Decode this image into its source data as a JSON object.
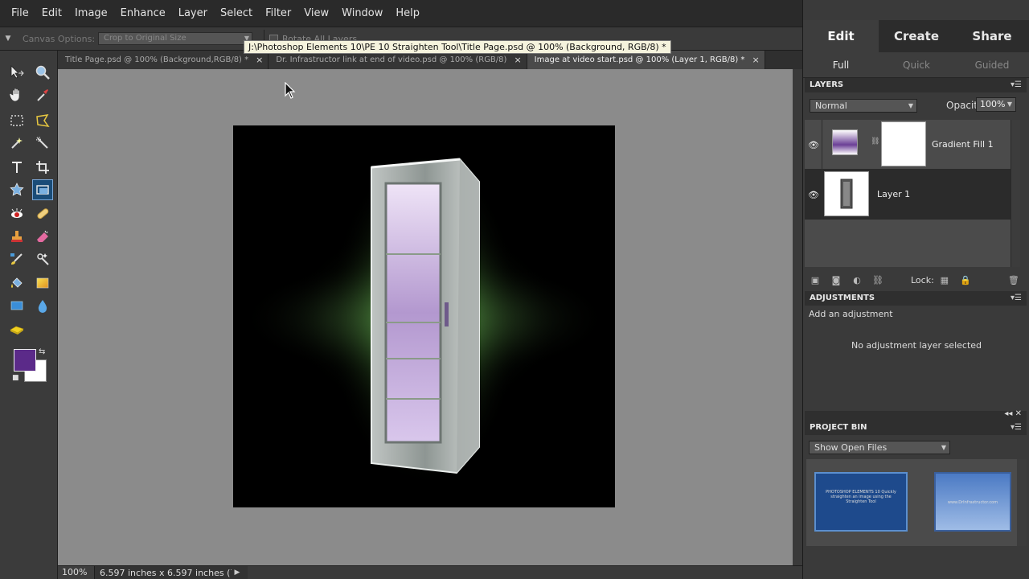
{
  "menu": [
    "File",
    "Edit",
    "Image",
    "Enhance",
    "Layer",
    "Select",
    "Filter",
    "View",
    "Window",
    "Help"
  ],
  "options_bar": {
    "canvas_options_label": "Canvas Options:",
    "canvas_options_value": "Crop to Original Size",
    "rotate_all_label": "Rotate All Layers"
  },
  "tooltip": "J:\\Photoshop Elements 10\\PE 10 Straighten Tool\\Title Page.psd @ 100% (Background, RGB/8) *",
  "doc_tabs": [
    {
      "label": "Title Page.psd @ 100% (Background,RGB/8) *",
      "close": "×"
    },
    {
      "label": "Dr. Infrastructor link at end of video.psd @ 100% (RGB/8)",
      "close": "×"
    },
    {
      "label": "Image at video start.psd @ 100% (Layer 1, RGB/8) *",
      "close": "×"
    }
  ],
  "status": {
    "zoom": "100%",
    "dimensions": "6.597 inches x 6.597 inches (7...",
    "arrow": "▶"
  },
  "colors": {
    "foreground": "#5b2a89",
    "background": "#ffffff",
    "active_tool": "#1a4c78"
  },
  "mode_tabs": [
    "Edit",
    "Create",
    "Share"
  ],
  "sub_tabs": [
    "Full",
    "Quick",
    "Guided"
  ],
  "layers_panel": {
    "title": "LAYERS",
    "blend_mode": "Normal",
    "opacity_label": "Opacity:",
    "opacity_value": "100%",
    "layers": [
      {
        "name": "Gradient Fill 1",
        "visible": true,
        "selected": false
      },
      {
        "name": "Layer 1",
        "visible": true,
        "selected": true
      }
    ],
    "lock_label": "Lock:"
  },
  "adjustments_panel": {
    "title": "ADJUSTMENTS",
    "add_label": "Add an adjustment",
    "empty_label": "No adjustment layer selected"
  },
  "project_bin": {
    "title": "PROJECT BIN",
    "filter_value": "Show Open Files",
    "thumb1_text": "PHOTOSHOP ELEMENTS 10 Quickly straighten an image using the Straighten Tool",
    "thumb2_text": "www.DrInfrastructor.com"
  },
  "tools": [
    "move-tool-icon",
    "zoom-tool-icon",
    "hand-tool-icon",
    "eyedropper-tool-icon",
    "marquee-tool-icon",
    "lasso-tool-icon",
    "magic-wand-tool-icon",
    "quick-selection-tool-icon",
    "type-tool-icon",
    "crop-tool-icon",
    "cookie-cutter-tool-icon",
    "straighten-tool-icon",
    "red-eye-tool-icon",
    "spot-healing-tool-icon",
    "clone-stamp-tool-icon",
    "eraser-tool-icon",
    "brush-tool-icon",
    "smart-brush-tool-icon",
    "paint-bucket-tool-icon",
    "gradient-tool-icon",
    "shape-tool-icon",
    "blur-tool-icon",
    "sponge-tool-icon"
  ]
}
